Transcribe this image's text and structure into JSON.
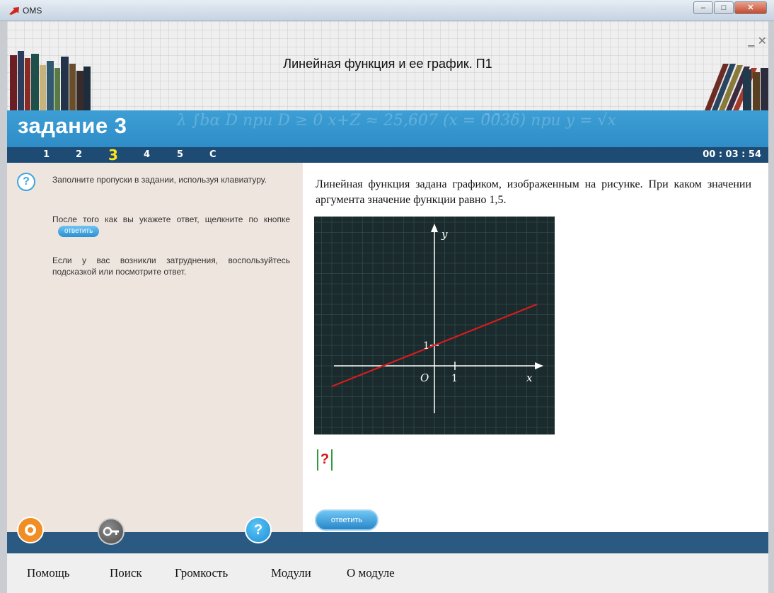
{
  "window": {
    "title": "OMS",
    "controls": {
      "minimize": "–",
      "maximize": "□",
      "close": "✕"
    }
  },
  "header": {
    "title": "Линейная функция и ее график. П1",
    "task_title": "задание 3",
    "formula_text": "λ   ∫b𝛼   D при D ≥ 0   x+Z ≈ 25,607   (x = 0̄0̄3δ)   при   y = √x"
  },
  "nav": {
    "tasks": [
      "1",
      "2",
      "3",
      "4",
      "5",
      "C"
    ],
    "active_task": "3",
    "timer": "00 : 03 : 54"
  },
  "instructions": {
    "p1": "Заполните пропуски в задании, используя клавиатуру.",
    "p2": "После того как вы укажете ответ, щелкните по кнопке",
    "p2_button": "ответить",
    "p3": "Если у вас возникли затруднения, воспользуйтесь подсказкой или посмотрите ответ."
  },
  "question": {
    "text": "Линейная функция задана графиком, изображенным на рисунке. При каком значении аргумента значение функции равно 1,5.",
    "answer_placeholder": "?",
    "submit_label": "ответить"
  },
  "graph": {
    "axis_x_label": "x",
    "axis_y_label": "y",
    "origin_label": "O",
    "tick_x_label": "1",
    "tick_y_label": "1",
    "line_start": [
      -5,
      -1
    ],
    "line_end": [
      5,
      3
    ],
    "line_color": "#d61c1c",
    "axis_color": "#ffffff",
    "grid_color": "#2f4a4c"
  },
  "bottom_buttons": {
    "lifebuoy": "lifebuoy-icon",
    "key": "key-icon",
    "help": "?"
  },
  "menu": {
    "items": [
      "Помощь",
      "Поиск",
      "Громкость",
      "Модули",
      "О модуле"
    ]
  }
}
